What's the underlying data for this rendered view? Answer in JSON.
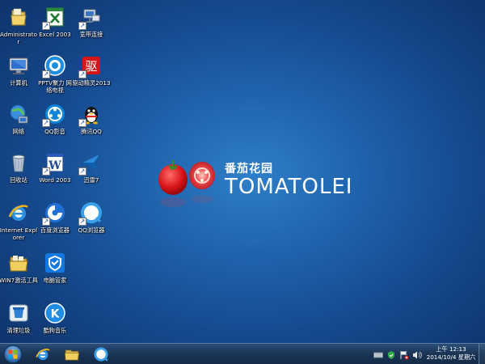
{
  "desktop_icons": [
    {
      "id": "administrator",
      "label": "Administrator",
      "icon": "user-folder-icon"
    },
    {
      "id": "excel",
      "label": "Excel 2003",
      "icon": "excel-icon"
    },
    {
      "id": "broadband",
      "label": "宽带连接",
      "icon": "network-connection-icon"
    },
    {
      "id": "computer",
      "label": "计算机",
      "icon": "computer-icon"
    },
    {
      "id": "pptv",
      "label": "PPTV聚力 网络电视",
      "icon": "pptv-icon"
    },
    {
      "id": "driver",
      "label": "驱动精灵2013",
      "icon": "driver-genius-icon"
    },
    {
      "id": "network",
      "label": "网络",
      "icon": "network-globe-icon"
    },
    {
      "id": "qqplayer",
      "label": "QQ影音",
      "icon": "qq-player-icon"
    },
    {
      "id": "qq",
      "label": "腾讯QQ",
      "icon": "qq-penguin-icon"
    },
    {
      "id": "recycle",
      "label": "回收站",
      "icon": "recycle-bin-icon"
    },
    {
      "id": "word",
      "label": "Word 2003",
      "icon": "word-icon"
    },
    {
      "id": "xunlei",
      "label": "迅雷7",
      "icon": "xunlei-icon"
    },
    {
      "id": "ie",
      "label": "Internet Explorer",
      "icon": "internet-explorer-icon"
    },
    {
      "id": "baidu",
      "label": "百度浏览器",
      "icon": "baidu-browser-icon"
    },
    {
      "id": "qqbrowser",
      "label": "QQ浏览器",
      "icon": "qq-browser-icon"
    },
    {
      "id": "win7tool",
      "label": "WIN7激活工具",
      "icon": "folder-icon"
    },
    {
      "id": "pcmanager",
      "label": "电脑管家",
      "icon": "pc-manager-shield-icon"
    },
    {
      "id": "cleaner",
      "label": "清理垃圾",
      "icon": "cleaner-icon"
    },
    {
      "id": "kugou",
      "label": "酷狗音乐",
      "icon": "kugou-icon"
    }
  ],
  "wallpaper": {
    "brand_cn": "番茄花园",
    "brand_en": "TOMATOLEI"
  },
  "taskbar": {
    "start_icon": "windows-start-icon",
    "pinned": [
      {
        "id": "ie",
        "icon": "internet-explorer-icon"
      },
      {
        "id": "explorer",
        "icon": "file-explorer-icon"
      },
      {
        "id": "qqbrowser",
        "icon": "qq-browser-icon"
      }
    ],
    "tray_icons": [
      "keyboard-icon",
      "security-icon",
      "flag-icon",
      "volume-icon"
    ],
    "time": "上午 12:13",
    "date": "2014/10/4 星期六"
  },
  "colors": {
    "desktop_center": "#2f7fc8",
    "desktop_edge": "#0d3168",
    "taskbar": "#1b3658"
  }
}
